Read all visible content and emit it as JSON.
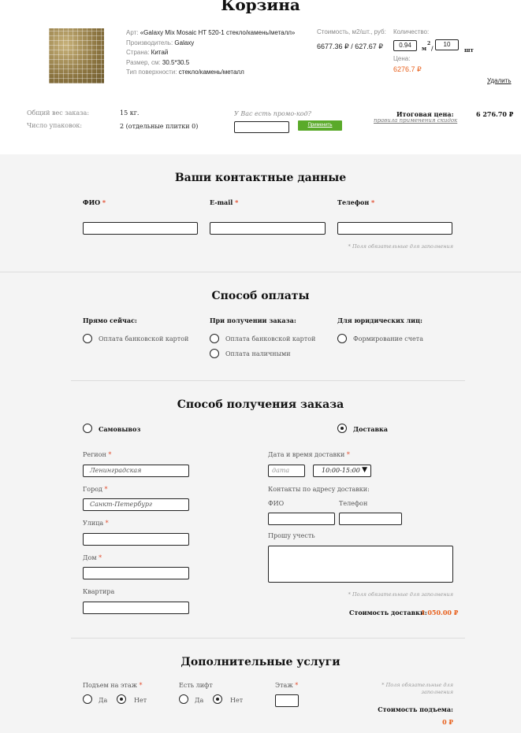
{
  "cart": {
    "title": "Корзина",
    "item": {
      "art_label": "Арт:",
      "art_value": "«Galaxy Mix Mosaic HT 520-1 стекло/камень/металл»",
      "maker_label": "Производитель:",
      "maker_value": "Galaxy",
      "country_label": "Страна:",
      "country_value": "Китай",
      "size_label": "Размер, см:",
      "size_value": "30.5*30.5",
      "surface_label": "Тип поверхности:",
      "surface_value": "стекло/камень/металл",
      "cost_label": "Стоимость, м2/шт., руб:",
      "cost_value": "6677.36 ₽ / 627.67 ₽",
      "qty_label": "Количество:",
      "qty_m2": "0.94",
      "qty_unit_m2": "м",
      "qty_sup": "2",
      "qty_slash": "/",
      "qty_pcs": "10",
      "qty_unit_pcs": "шт",
      "price_label": "Цена:",
      "price_value": "6276.7 ₽",
      "delete": "Удалить"
    },
    "summary": {
      "weight_label": "Общий вес заказа:",
      "weight_value": "15 кг.",
      "packs_label": "Число упаковок:",
      "packs_value_a": "2",
      "packs_value_b": "(отдельные плитки",
      "packs_value_c": "0",
      "packs_value_d": ")",
      "promo_label": "У Вас есть промо-код?",
      "promo_button": "Применить",
      "total_label": "Итоговая цена:",
      "total_value": "6 276.70 ₽",
      "discount_link": "правила применения скидок"
    }
  },
  "contacts": {
    "title": "Ваши контактные данные",
    "fio": "ФИО",
    "email": "E-mail",
    "phone": "Телефон",
    "required_mark": "*",
    "required_note": "* Поля обязательные для заполнения"
  },
  "payment": {
    "title": "Способ оплаты",
    "col1_title": "Прямо сейчас:",
    "col1_opt1": "Оплата банковской картой",
    "col2_title": "При получении заказа:",
    "col2_opt1": "Оплата банковской картой",
    "col2_opt2": "Оплата наличными",
    "col3_title": "Для юридических лиц:",
    "col3_opt1": "Формирование счета"
  },
  "delivery": {
    "title": "Способ получения заказа",
    "pickup": "Самовывоз",
    "delivery": "Доставка",
    "region_label": "Регион",
    "region_value": "Ленинградская",
    "city_label": "Город",
    "city_value": "Санкт-Петербург",
    "street_label": "Улица",
    "house_label": "Дом",
    "flat_label": "Квартира",
    "datetime_label": "Дата и время доставки",
    "date_placeholder": "дата",
    "time_value": "10:00-15:00",
    "time_arrow": "▼",
    "contacts_label": "Контакты по адресу доставки:",
    "fio_label": "ФИО",
    "phone_label": "Телефон",
    "note_label": "Прошу учесть",
    "required_note": "* Поля обязательные для заполнения",
    "cost_label": "Стоимость доставки:",
    "cost_value": "1 050.00 ₽"
  },
  "extra": {
    "title": "Дополнительные услуги",
    "lift_floor_label": "Подъем на этаж",
    "has_lift_label": "Есть лифт",
    "floor_label": "Этаж",
    "yes": "Да",
    "no": "Нет",
    "required_note_1": "* Поля обязательные для",
    "required_note_2": "заполнения",
    "lift_cost_label": "Стоимость подъема:",
    "lift_cost_value": "0 ₽"
  },
  "colors": {
    "accent": "#e8601c",
    "button": "#5aaa2a",
    "required": "#e24a2b",
    "section_bg": "#f4f4f4"
  }
}
